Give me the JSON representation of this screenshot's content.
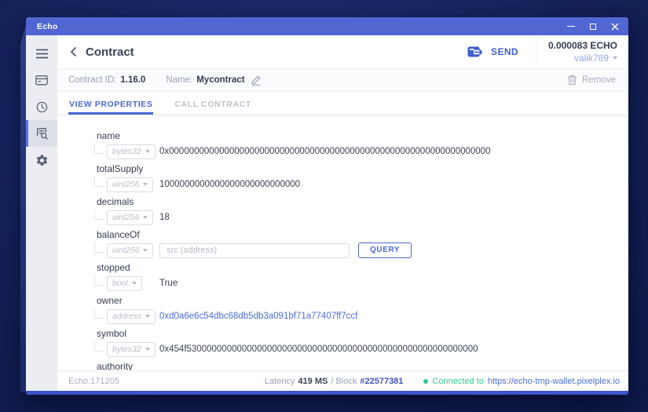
{
  "app": {
    "title": "Echo"
  },
  "window_controls": {
    "minimize": "minimize",
    "maximize": "maximize",
    "close": "close"
  },
  "sidebar": {
    "items": [
      {
        "icon": "menu-icon",
        "selected": false
      },
      {
        "icon": "wallet-icon",
        "selected": false
      },
      {
        "icon": "history-icon",
        "selected": false
      },
      {
        "icon": "contracts-icon",
        "selected": true
      },
      {
        "icon": "settings-icon",
        "selected": false
      }
    ]
  },
  "header": {
    "title": "Contract",
    "send_label": "SEND",
    "balance": "0.000083 ECHO",
    "account": "valik789"
  },
  "contract_bar": {
    "id_label": "Contract ID:",
    "id_value": "1.16.0",
    "name_label": "Name:",
    "name_value": "Mycontract",
    "remove_label": "Remove"
  },
  "tabs": [
    {
      "label": "VIEW PROPERTIES",
      "active": true
    },
    {
      "label": "CALL CONTRACT",
      "active": false
    }
  ],
  "properties": [
    {
      "name": "name",
      "type": "bytes32",
      "value": "0x0000000000000000000000000000000000000000000000000000000000000000"
    },
    {
      "name": "totalSupply",
      "type": "uint256",
      "value": "1000000000000000000000000000"
    },
    {
      "name": "decimals",
      "type": "uint256",
      "value": "18"
    },
    {
      "name": "balanceOf",
      "type": "uint256",
      "input_placeholder": "src (address)",
      "button": "QUERY"
    },
    {
      "name": "stopped",
      "type": "bool",
      "value": "True"
    },
    {
      "name": "owner",
      "type": "address",
      "value": "0xd0a6e6c54dbc68db5db3a091bf71a77407ff7ccf",
      "link": true
    },
    {
      "name": "symbol",
      "type": "bytes32",
      "value": "0x454f5300000000000000000000000000000000000000000000000000000000"
    },
    {
      "name": "authority"
    }
  ],
  "footer": {
    "version": "Echo.171205",
    "latency_label": "Latency",
    "latency_value": "419 MS",
    "block_label": "/ Block",
    "block_value": "#22577381",
    "connected_label": "Connected to",
    "connected_url": "https://echo-tmp-wallet.pixelplex.io"
  },
  "colors": {
    "titlebar": "#5266d2",
    "accent": "#4a69d4",
    "connected_green": "#2fcb8e",
    "link_blue": "#4a6fd8"
  }
}
